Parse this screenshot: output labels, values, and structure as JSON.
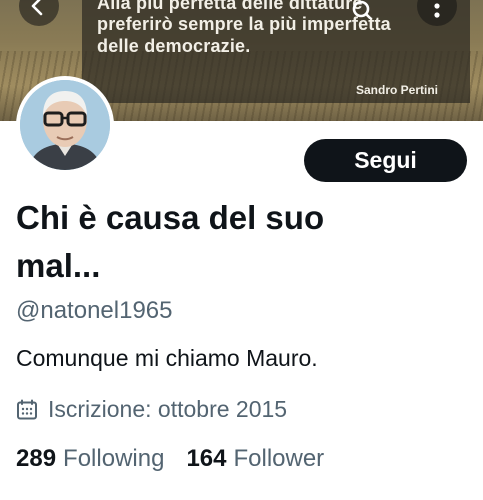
{
  "banner": {
    "quote_lines": [
      "Alla più perfetta delle dittature",
      "preferirò sempre la più imperfetta",
      "delle democrazie."
    ],
    "author": "Sandro Pertini"
  },
  "nav": {
    "back_icon": "back-arrow-icon",
    "search_icon": "search-icon",
    "more_icon": "more-vertical-icon"
  },
  "profile": {
    "display_name": "Chi è causa del suo mal...",
    "handle": "@natonel1965",
    "bio": "Comunque mi chiamo Mauro.",
    "joined": "Iscrizione: ottobre 2015",
    "follow_label": "Segui",
    "following_count": "289",
    "following_label": "Following",
    "followers_count": "164",
    "followers_label": "Follower"
  },
  "colors": {
    "primary_text": "#0f1419",
    "secondary_text": "#536471",
    "follow_button": "#0f1419"
  }
}
